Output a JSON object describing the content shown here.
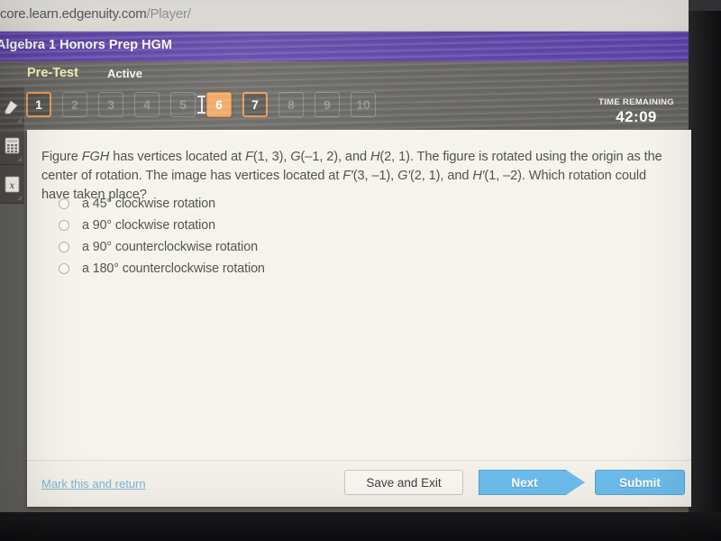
{
  "browser": {
    "url": "core.learn.edgenuity.com",
    "url_path": "/Player/"
  },
  "header": {
    "course_title": "Algebra 1 Honors Prep HGM",
    "assignment_type": "Pre-Test",
    "assignment_state": "Active",
    "banner_color": "#5b40a8"
  },
  "tools": [
    {
      "name": "highlighter-tool",
      "icon": "highlighter-icon"
    },
    {
      "name": "calculator-tool",
      "icon": "calculator-icon"
    },
    {
      "name": "formula-tool",
      "icon": "formula-icon"
    }
  ],
  "question_nav": {
    "accent_color": "#f0a258",
    "items": [
      {
        "label": "1",
        "state": "seen"
      },
      {
        "label": "2",
        "state": "dim"
      },
      {
        "label": "3",
        "state": "dim"
      },
      {
        "label": "4",
        "state": "dim"
      },
      {
        "label": "5",
        "state": "dim"
      },
      {
        "label": "6",
        "state": "current"
      },
      {
        "label": "7",
        "state": "seen"
      },
      {
        "label": "8",
        "state": "dim"
      },
      {
        "label": "9",
        "state": "dim"
      },
      {
        "label": "10",
        "state": "dim"
      }
    ]
  },
  "timer": {
    "label": "TIME REMAINING",
    "value": "42:09"
  },
  "question": {
    "line1_a": "Figure ",
    "line1_fgh": "FGH",
    "line1_b": " has vertices located at ",
    "line1_f": "F",
    "line1_c": "(1, 3), ",
    "line1_g": "G",
    "line1_d": "(–1, 2), and ",
    "line1_h": "H",
    "line1_e": "(2, 1). The figure is rotated using the origin as the center of rotation. The image has vertices located at ",
    "line2_f": "F′",
    "line2_a": "(3, –1), ",
    "line2_g": "G′",
    "line2_b": "(2, 1), and ",
    "line2_h": "H′",
    "line2_c": "(1, –2). Which rotation could have taken place?"
  },
  "choices": [
    {
      "label": "a 45° clockwise rotation",
      "selected": false
    },
    {
      "label": "a 90° clockwise rotation",
      "selected": false
    },
    {
      "label": "a 90° counterclockwise rotation",
      "selected": false
    },
    {
      "label": "a 180° counterclockwise rotation",
      "selected": false
    }
  ],
  "footer": {
    "mark_link": "Mark this and return",
    "save_label": "Save and Exit",
    "next_label": "Next",
    "submit_label": "Submit",
    "primary_button_color": "#6cbceb",
    "link_color": "#7fb6d4"
  }
}
